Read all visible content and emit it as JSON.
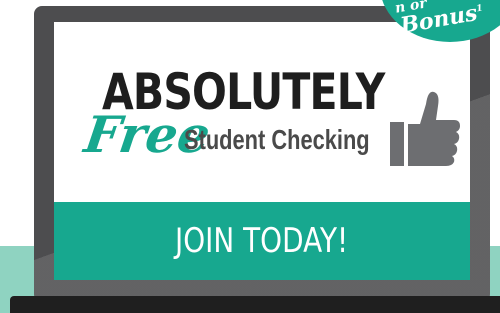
{
  "ad": {
    "headline": "ABSOLUTELY",
    "free_word": "Free",
    "product": "Student Checking",
    "cta_label": "JOIN TODAY!"
  },
  "badge": {
    "line1": "n or",
    "line2": "Bonus",
    "footnote_mark": "1"
  },
  "icons": {
    "thumb": "thumbs-up-icon"
  },
  "colors": {
    "accent": "#17a88f",
    "desk": "#8fd3c1",
    "laptop": "#4d4d4f",
    "headline": "#1e1e1e",
    "product": "#4a4a4a",
    "thumb": "#6d6e71"
  }
}
